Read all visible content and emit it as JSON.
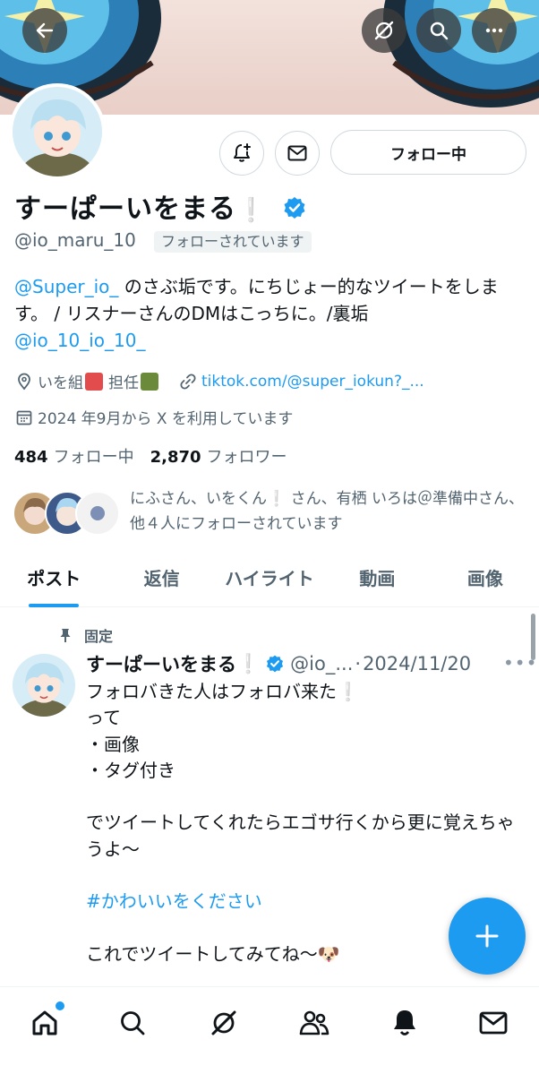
{
  "profile": {
    "name": "すーぱーいをまる",
    "name_suffix_emoji": "❕",
    "handle": "@io_maru_10",
    "follows_you": "フォローされています",
    "follow_state": "フォロー中",
    "bio_mention": "@Super_io_",
    "bio_text": " のさぶ垢です。にちじょー的なツイートをします。 / リスナーさんのDMはこっちに。/裏垢",
    "bio_link": "@io_10_io_10_",
    "location_a": "いを組",
    "location_b": "担任",
    "url": "tiktok.com/@super_iokun?_...",
    "joined": "2024 年9月から X を利用しています",
    "following_count": "484",
    "following_label": "フォロー中",
    "followers_count": "2,870",
    "followers_label": "フォロワー",
    "followed_by": "にふさん、いをくん❕ さん、有栖 いろは＠準備中さん、他４人にフォローされています"
  },
  "tabs": [
    {
      "label": "ポスト",
      "active": true
    },
    {
      "label": "返信",
      "active": false
    },
    {
      "label": "ハイライト",
      "active": false
    },
    {
      "label": "動画",
      "active": false
    },
    {
      "label": "画像",
      "active": false
    }
  ],
  "pinned_post": {
    "pinned_label": "固定",
    "author_name": "すーぱーいをまる",
    "author_emoji": "❕",
    "handle_short": "@io_...",
    "separator": "·",
    "date": "2024/11/20",
    "more": "•••",
    "line1": "フォロバきた人はフォロバ来た",
    "line1_emoji": "❕",
    "body_a": "って\n・画像\n・タグ付き\n\nでツイートしてくれたらエゴサ行くから更に覚えちゃうよ〜\n",
    "hashtag": "#かわいいをください",
    "body_b": "これでツイートしてみてね〜🐶"
  },
  "icons": {
    "back": "arrow-left-icon",
    "grok": "grok-slash-icon",
    "search": "search-icon",
    "more": "more-horizontal-icon",
    "notify": "bell-plus-icon",
    "message": "envelope-icon",
    "location": "location-pin-icon",
    "link": "link-icon",
    "calendar": "calendar-icon",
    "pin": "pin-icon",
    "verified": "verified-badge-icon",
    "compose": "plus-icon",
    "nav": [
      "home-icon",
      "search-icon",
      "grok-icon",
      "communities-icon",
      "bell-icon",
      "envelope-icon"
    ]
  },
  "colors": {
    "accent": "#1d9bf0",
    "text": "#0f1419",
    "secondary": "#536471"
  }
}
